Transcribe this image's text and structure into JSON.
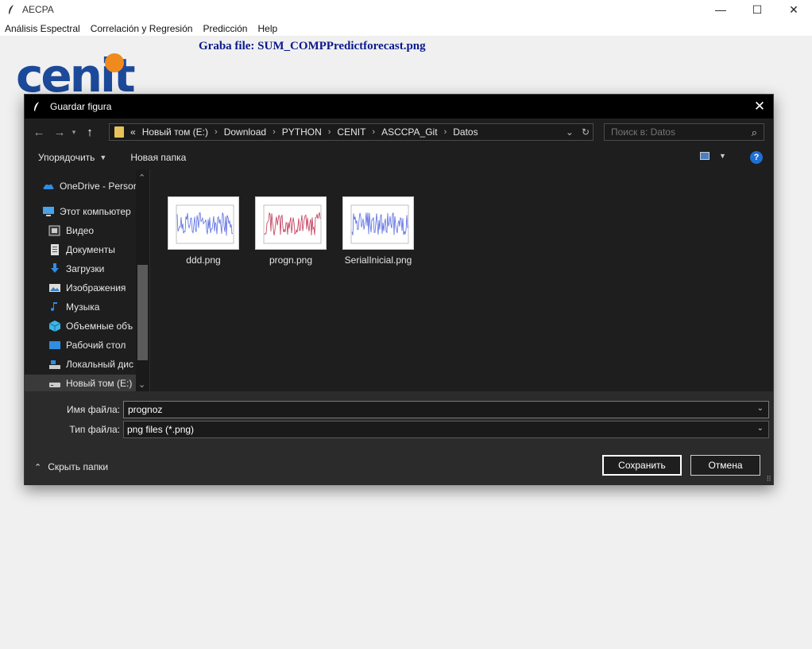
{
  "window": {
    "title": "AECPA",
    "controls": {
      "minimize": "—",
      "maximize": "☐",
      "close": "✕"
    }
  },
  "menubar": {
    "items": [
      "Análisis Espectral",
      "Correlación y Regresión",
      "Predicción",
      "Help"
    ]
  },
  "graba_label": "Graba file: SUM_COMPPredictforecast.png",
  "logo": {
    "text": "cenit",
    "accent_color": "#f08a1c",
    "text_color": "#1c4a9a"
  },
  "dialog": {
    "title": "Guardar figura",
    "address": {
      "overflow": "«",
      "crumbs": [
        "Новый том (E:)",
        "Download",
        "PYTHON",
        "CENIT",
        "ASCCPA_Git",
        "Datos"
      ]
    },
    "search": {
      "placeholder": "Поиск в: Datos"
    },
    "toolbar": {
      "organize": "Упорядочить",
      "new_folder": "Новая папка",
      "help": "?"
    },
    "nav_items": [
      {
        "label": "OneDrive - Persor",
        "icon": "onedrive-icon"
      },
      {
        "label": "Этот компьютер",
        "icon": "computer-icon"
      },
      {
        "label": "Видео",
        "icon": "video-icon"
      },
      {
        "label": "Документы",
        "icon": "documents-icon"
      },
      {
        "label": "Загрузки",
        "icon": "downloads-icon"
      },
      {
        "label": "Изображения",
        "icon": "pictures-icon"
      },
      {
        "label": "Музыка",
        "icon": "music-icon"
      },
      {
        "label": "Объемные объ",
        "icon": "3d-objects-icon"
      },
      {
        "label": "Рабочий стол",
        "icon": "desktop-icon"
      },
      {
        "label": "Локальный дис",
        "icon": "local-disk-icon"
      },
      {
        "label": "Новый том (E:)",
        "icon": "drive-icon"
      }
    ],
    "files": [
      {
        "name": "ddd.png",
        "line_color": "#5a6de0"
      },
      {
        "name": "progn.png",
        "line_color": "#c03a5a"
      },
      {
        "name": "SerialInicial.png",
        "line_color": "#5a6de0"
      }
    ],
    "filename": {
      "label": "Имя файла:",
      "value": "prognoz"
    },
    "filetype": {
      "label": "Тип файла:",
      "value": "png files (*.png)"
    },
    "hide_folders": "Скрыть папки",
    "save_button": "Сохранить",
    "cancel_button": "Отмена"
  }
}
